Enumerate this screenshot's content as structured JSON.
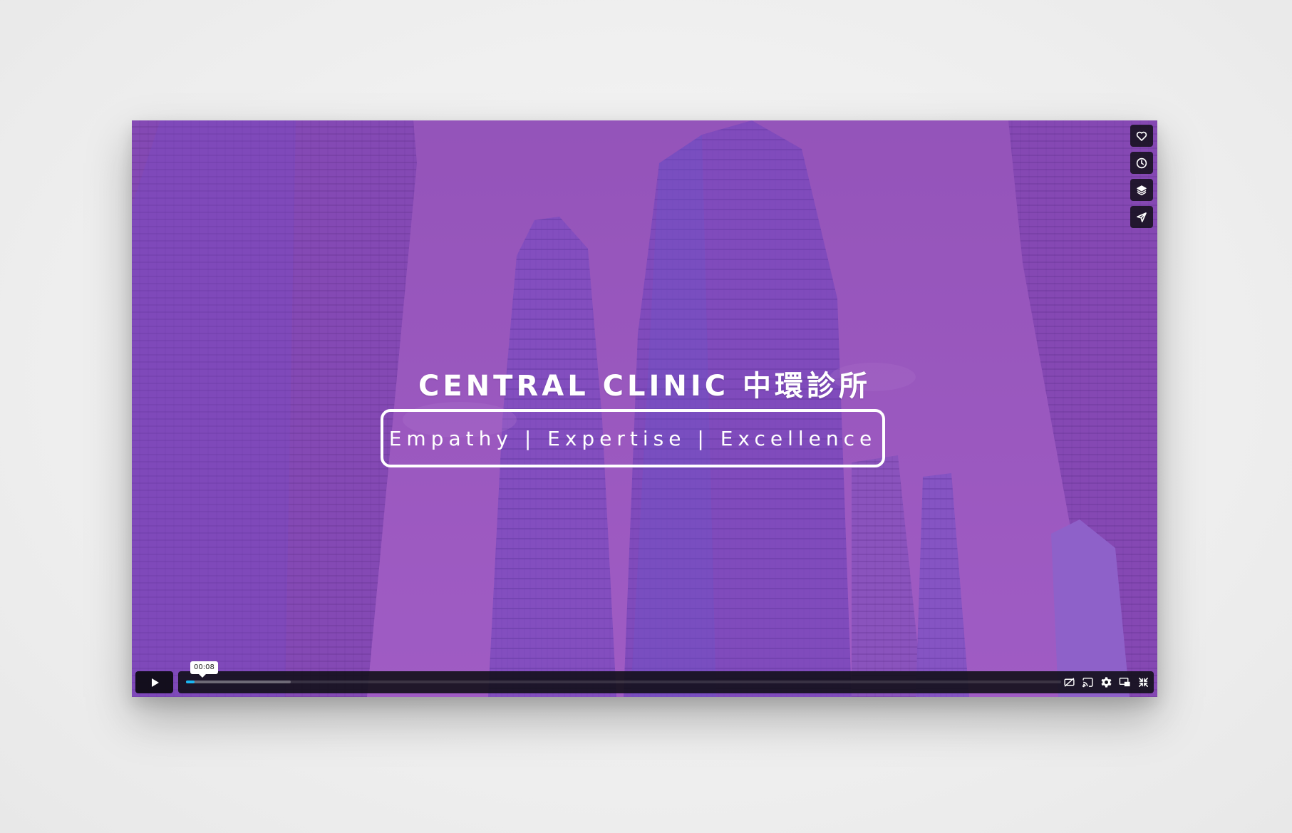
{
  "video": {
    "title": "CENTRAL CLINIC 中環診所",
    "tagline": "Empathy | Expertise | Excellence",
    "tint_color": "#8a4fb0"
  },
  "side_controls": [
    "heart-icon",
    "clock-icon",
    "layers-icon",
    "send-icon"
  ],
  "controls": {
    "tooltip_time": "00:08",
    "progress_played_fraction": 0.01,
    "progress_buffered_fraction": 0.12,
    "accent_color": "#19b6f2",
    "icons": [
      "play-icon",
      "captions-off-icon",
      "cast-icon",
      "settings-icon",
      "pip-icon",
      "fullscreen-exit-icon"
    ]
  }
}
